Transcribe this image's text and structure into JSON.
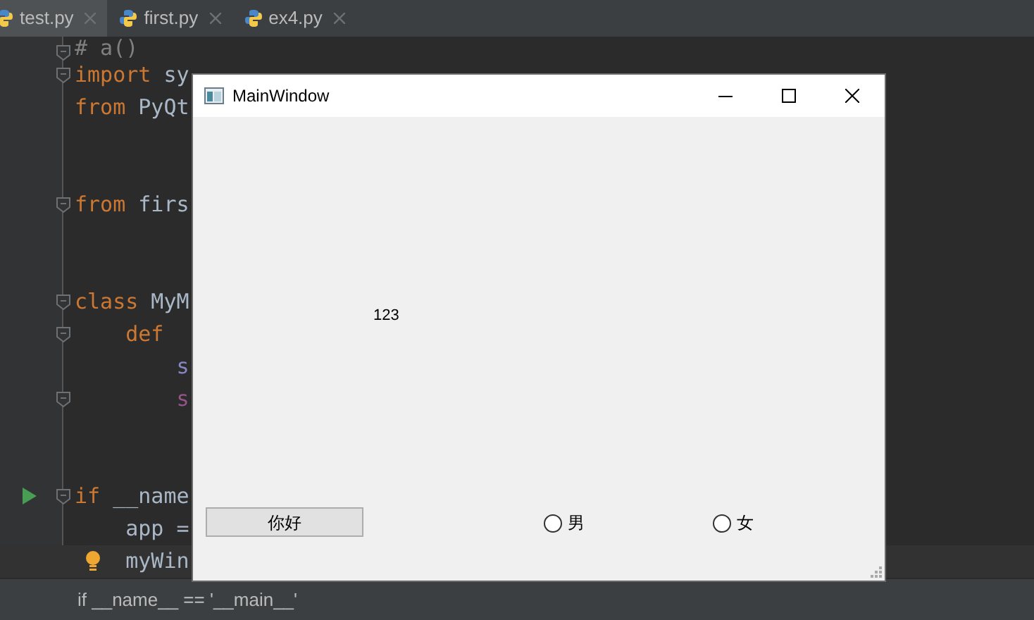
{
  "editor_tabs": [
    {
      "label": "test.py",
      "selected": true
    },
    {
      "label": "first.py",
      "selected": false
    },
    {
      "label": "ex4.py",
      "selected": false
    }
  ],
  "code_lines": [
    {
      "fold": true,
      "runnable": false,
      "hint": false,
      "current": false,
      "tokens": [
        {
          "kind": "comment",
          "text": "# a()"
        }
      ]
    },
    {
      "fold": true,
      "runnable": false,
      "hint": false,
      "current": false,
      "tokens": [
        {
          "kind": "keyword",
          "text": "import"
        },
        {
          "kind": "plain",
          "text": " sy"
        }
      ]
    },
    {
      "fold": false,
      "runnable": false,
      "hint": false,
      "current": false,
      "tokens": [
        {
          "kind": "keyword",
          "text": "from"
        },
        {
          "kind": "plain",
          "text": " PyQt"
        }
      ]
    },
    {
      "fold": false,
      "runnable": false,
      "hint": false,
      "current": false
    },
    {
      "fold": false,
      "runnable": false,
      "hint": false,
      "current": false
    },
    {
      "fold": true,
      "runnable": false,
      "hint": false,
      "current": false,
      "tokens": [
        {
          "kind": "keyword",
          "text": "from"
        },
        {
          "kind": "plain",
          "text": " firs"
        }
      ]
    },
    {
      "fold": false,
      "runnable": false,
      "hint": false,
      "current": false
    },
    {
      "fold": false,
      "runnable": false,
      "hint": false,
      "current": false
    },
    {
      "fold": true,
      "runnable": false,
      "hint": false,
      "current": false,
      "tokens": [
        {
          "kind": "keyword",
          "text": "class"
        },
        {
          "kind": "plain",
          "text": " MyM"
        }
      ]
    },
    {
      "fold": true,
      "runnable": false,
      "hint": false,
      "current": false,
      "tokens": [
        {
          "kind": "keyword",
          "text": "    def"
        }
      ]
    },
    {
      "fold": false,
      "runnable": false,
      "hint": false,
      "current": false,
      "tokens": [
        {
          "kind": "call",
          "text": "        s"
        }
      ]
    },
    {
      "fold": true,
      "runnable": false,
      "hint": false,
      "current": false,
      "tokens": [
        {
          "kind": "self",
          "text": "        s"
        }
      ]
    },
    {
      "fold": false,
      "runnable": false,
      "hint": false,
      "current": false
    },
    {
      "fold": false,
      "runnable": false,
      "hint": false,
      "current": false
    },
    {
      "fold": true,
      "runnable": true,
      "hint": false,
      "current": false,
      "tokens": [
        {
          "kind": "keyword",
          "text": "if"
        },
        {
          "kind": "plain",
          "text": " __name"
        }
      ]
    },
    {
      "fold": false,
      "runnable": false,
      "hint": false,
      "current": false,
      "tokens": [
        {
          "kind": "plain",
          "text": "    app ="
        }
      ]
    },
    {
      "fold": false,
      "runnable": false,
      "hint": true,
      "current": true,
      "tokens": [
        {
          "kind": "plain",
          "text": "    myWin"
        }
      ]
    }
  ],
  "breadcrumb": "if __name__ == '__main__'",
  "app_window": {
    "title": "MainWindow",
    "label": "123",
    "button": "你好",
    "radios": [
      {
        "label": "男",
        "selected": false
      },
      {
        "label": "女",
        "selected": false
      }
    ]
  }
}
